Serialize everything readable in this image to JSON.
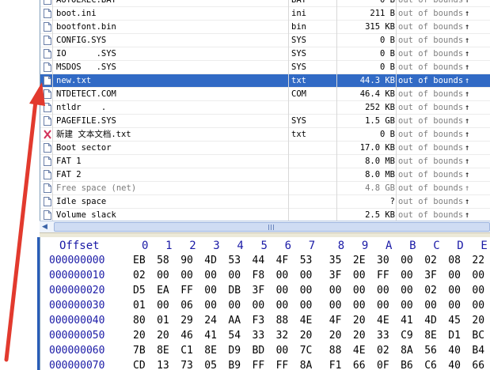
{
  "files": [
    {
      "name": "AUTOEXEC.BAT",
      "ext": "BAT",
      "size": "0 B",
      "status": "out of bounds",
      "arrow": "↑",
      "icon": "file-icon"
    },
    {
      "name": "boot.ini",
      "ext": "ini",
      "size": "211 B",
      "status": "out of bounds",
      "arrow": "↑",
      "icon": "file-icon"
    },
    {
      "name": "bootfont.bin",
      "ext": "bin",
      "size": "315 KB",
      "status": "out of bounds",
      "arrow": "↑",
      "icon": "file-icon"
    },
    {
      "name": "CONFIG.SYS",
      "ext": "SYS",
      "size": "0 B",
      "status": "out of bounds",
      "arrow": "↑",
      "icon": "file-icon"
    },
    {
      "name": "IO      .SYS",
      "ext": "SYS",
      "size": "0 B",
      "status": "out of bounds",
      "arrow": "↑",
      "icon": "file-icon"
    },
    {
      "name": "MSDOS   .SYS",
      "ext": "SYS",
      "size": "0 B",
      "status": "out of bounds",
      "arrow": "↑",
      "icon": "file-icon"
    },
    {
      "name": "new.txt",
      "ext": "txt",
      "size": "44.3 KB",
      "status": "out of bounds",
      "arrow": "↑",
      "icon": "file-icon",
      "selected": true
    },
    {
      "name": "NTDETECT.COM",
      "ext": "COM",
      "size": "46.4 KB",
      "status": "out of bounds",
      "arrow": "↑",
      "icon": "file-icon"
    },
    {
      "name": "ntldr    .",
      "ext": "",
      "size": "252 KB",
      "status": "out of bounds",
      "arrow": "↑",
      "icon": "file-icon"
    },
    {
      "name": "PAGEFILE.SYS",
      "ext": "SYS",
      "size": "1.5 GB",
      "status": "out of bounds",
      "arrow": "↑",
      "icon": "file-icon"
    },
    {
      "name": "新建 文本文档.txt",
      "ext": "txt",
      "size": "0 B",
      "status": "out of bounds",
      "arrow": "↑",
      "icon": "deleted-file-icon"
    },
    {
      "name": "Boot sector",
      "ext": "",
      "size": "17.0 KB",
      "status": "out of bounds",
      "arrow": "↑",
      "icon": "file-icon"
    },
    {
      "name": "FAT 1",
      "ext": "",
      "size": "8.0 MB",
      "status": "out of bounds",
      "arrow": "↑",
      "icon": "file-icon"
    },
    {
      "name": "FAT 2",
      "ext": "",
      "size": "8.0 MB",
      "status": "out of bounds",
      "arrow": "↑",
      "icon": "file-icon"
    },
    {
      "name": "Free space (net)",
      "ext": "",
      "size": "4.8 GB",
      "status": "out of bounds",
      "arrow": "↑",
      "icon": "file-icon",
      "dim": true
    },
    {
      "name": "Idle space",
      "ext": "",
      "size": "?",
      "status": "out of bounds",
      "arrow": "↑",
      "icon": "file-icon"
    },
    {
      "name": "Volume slack",
      "ext": "",
      "size": "2.5 KB",
      "status": "out of bounds",
      "arrow": "↑",
      "icon": "file-icon"
    }
  ],
  "hex": {
    "header_label": "Offset",
    "columns": [
      "0",
      "1",
      "2",
      "3",
      "4",
      "5",
      "6",
      "7",
      "8",
      "9",
      "A",
      "B",
      "C",
      "D",
      "E"
    ],
    "rows": [
      {
        "offset": "000000000",
        "bytes": [
          "EB",
          "58",
          "90",
          "4D",
          "53",
          "44",
          "4F",
          "53",
          "35",
          "2E",
          "30",
          "00",
          "02",
          "08",
          "22"
        ]
      },
      {
        "offset": "000000010",
        "bytes": [
          "02",
          "00",
          "00",
          "00",
          "00",
          "F8",
          "00",
          "00",
          "3F",
          "00",
          "FF",
          "00",
          "3F",
          "00",
          "00"
        ]
      },
      {
        "offset": "000000020",
        "bytes": [
          "D5",
          "EA",
          "FF",
          "00",
          "DB",
          "3F",
          "00",
          "00",
          "00",
          "00",
          "00",
          "00",
          "02",
          "00",
          "00"
        ]
      },
      {
        "offset": "000000030",
        "bytes": [
          "01",
          "00",
          "06",
          "00",
          "00",
          "00",
          "00",
          "00",
          "00",
          "00",
          "00",
          "00",
          "00",
          "00",
          "00"
        ]
      },
      {
        "offset": "000000040",
        "bytes": [
          "80",
          "01",
          "29",
          "24",
          "AA",
          "F3",
          "88",
          "4E",
          "4F",
          "20",
          "4E",
          "41",
          "4D",
          "45",
          "20"
        ]
      },
      {
        "offset": "000000050",
        "bytes": [
          "20",
          "20",
          "46",
          "41",
          "54",
          "33",
          "32",
          "20",
          "20",
          "20",
          "33",
          "C9",
          "8E",
          "D1",
          "BC"
        ]
      },
      {
        "offset": "000000060",
        "bytes": [
          "7B",
          "8E",
          "C1",
          "8E",
          "D9",
          "BD",
          "00",
          "7C",
          "88",
          "4E",
          "02",
          "8A",
          "56",
          "40",
          "B4"
        ]
      },
      {
        "offset": "000000070",
        "bytes": [
          "CD",
          "13",
          "73",
          "05",
          "B9",
          "FF",
          "FF",
          "8A",
          "F1",
          "66",
          "0F",
          "B6",
          "C6",
          "40",
          "66"
        ]
      }
    ]
  },
  "scrollbar": {
    "left_arrow": "◀"
  },
  "colors": {
    "selection": "#316ac5",
    "hex_blue": "#1a1aa6",
    "annotation_arrow": "#e23a2e"
  }
}
